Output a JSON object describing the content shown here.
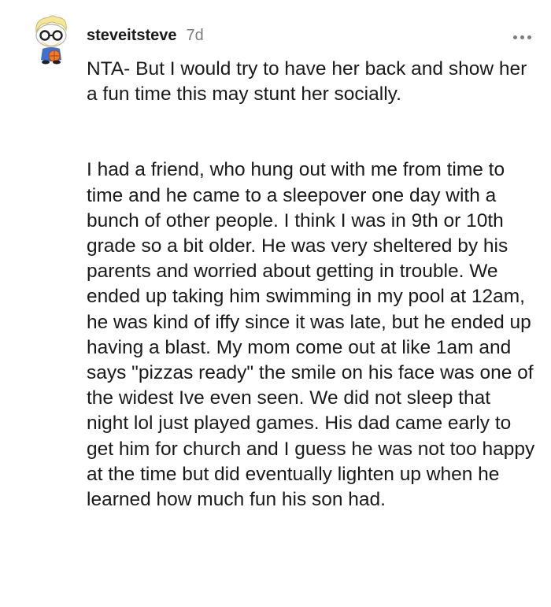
{
  "comment": {
    "username": "steveitsteve",
    "age": "7d",
    "avatar_icon": "snoo-avatar-icon",
    "more_icon": "more-options-icon",
    "paragraphs": [
      "NTA- But I would try to have her back and show her a fun time this may stunt her socially.",
      "I had a friend, who hung out with me from time to time and he came to a sleepover one day with a bunch of other people. I think I was in 9th or 10th grade so a bit older. He was very sheltered by his parents and worried about getting in trouble. We ended up taking him swimming in my pool at 12am, he was kind of iffy since it was late, but he ended up having a blast. My mom come out at like 1am and says \"pizzas ready\" the smile on his face was one of the widest Ive even seen. We did not sleep that night lol just played games. His dad came early to get him for church and I guess he was not too happy at the time but did eventually lighten up when he learned how much fun his son had."
    ]
  }
}
